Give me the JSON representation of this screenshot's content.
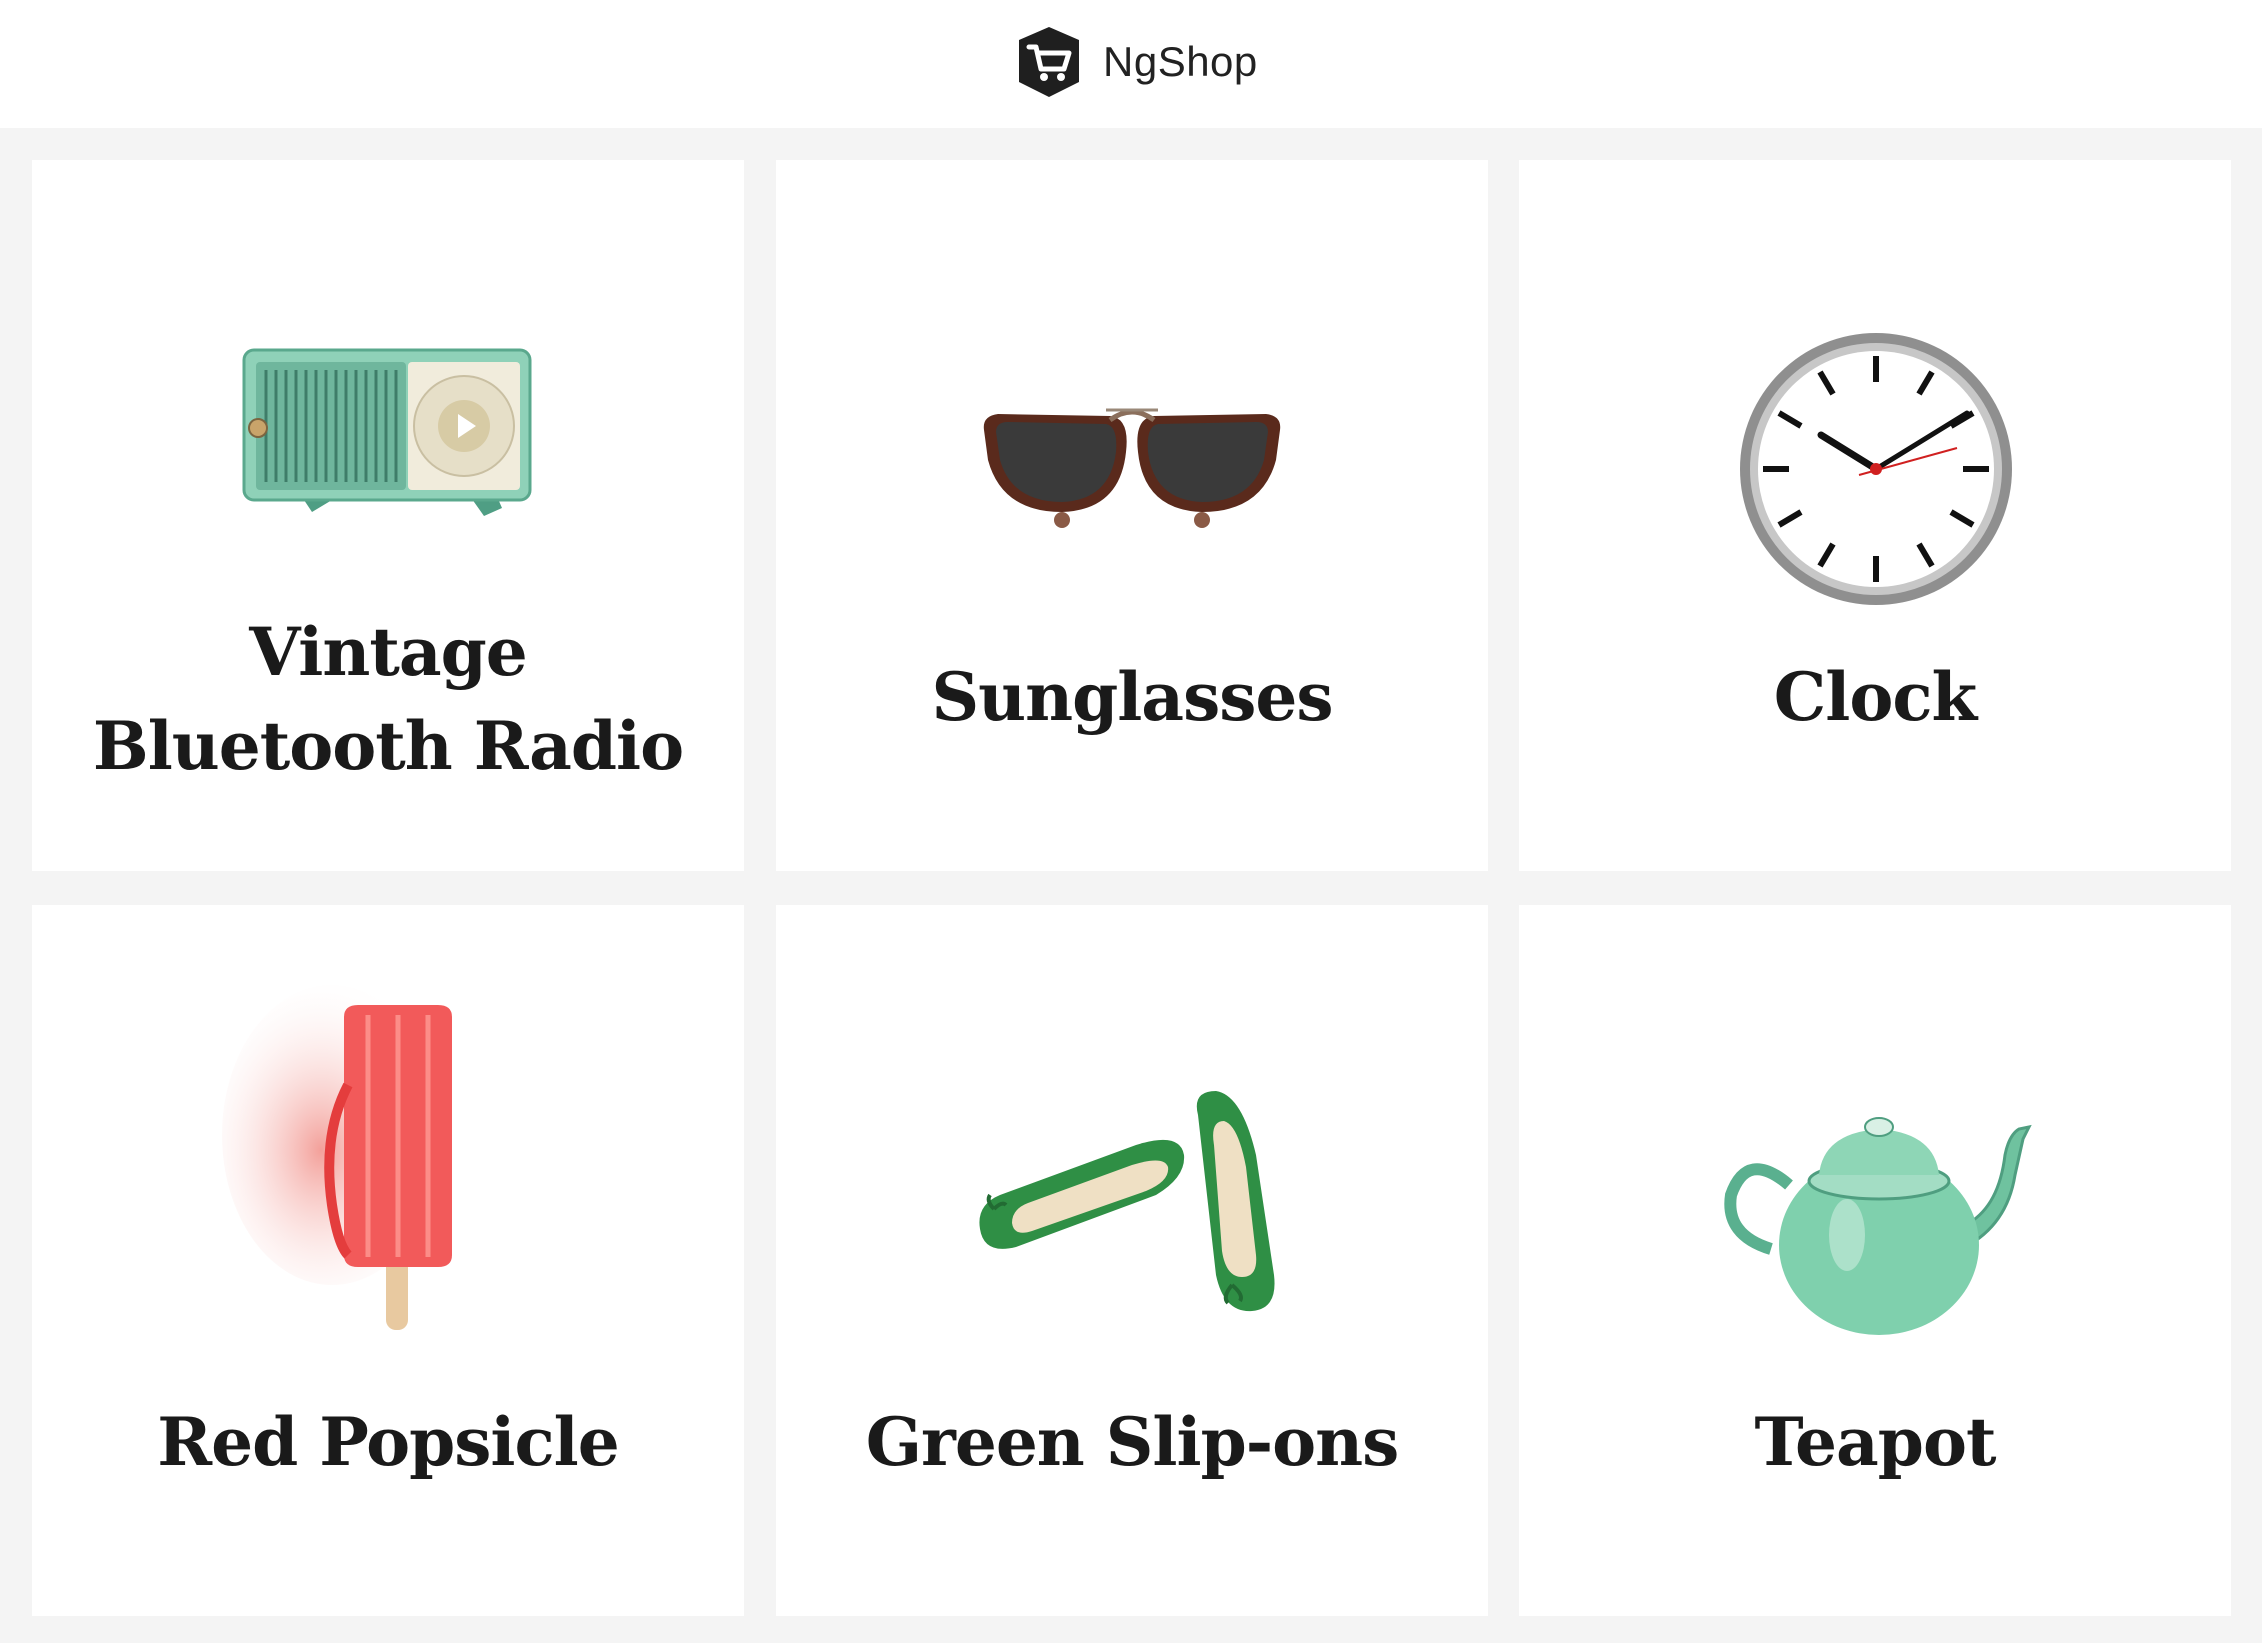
{
  "header": {
    "brand_name": "NgShop",
    "logo_icon": "shopping-cart-icon"
  },
  "colors": {
    "page_background": "#f4f4f4",
    "card_background": "#ffffff",
    "title_text": "#1a1a1a"
  },
  "products": [
    {
      "name": "Vintage Bluetooth Radio",
      "image_icon": "radio-image"
    },
    {
      "name": "Sunglasses",
      "image_icon": "sunglasses-image"
    },
    {
      "name": "Clock",
      "image_icon": "clock-image"
    },
    {
      "name": "Red Popsicle",
      "image_icon": "popsicle-image"
    },
    {
      "name": "Green Slip-ons",
      "image_icon": "slip-ons-image"
    },
    {
      "name": "Teapot",
      "image_icon": "teapot-image"
    }
  ]
}
